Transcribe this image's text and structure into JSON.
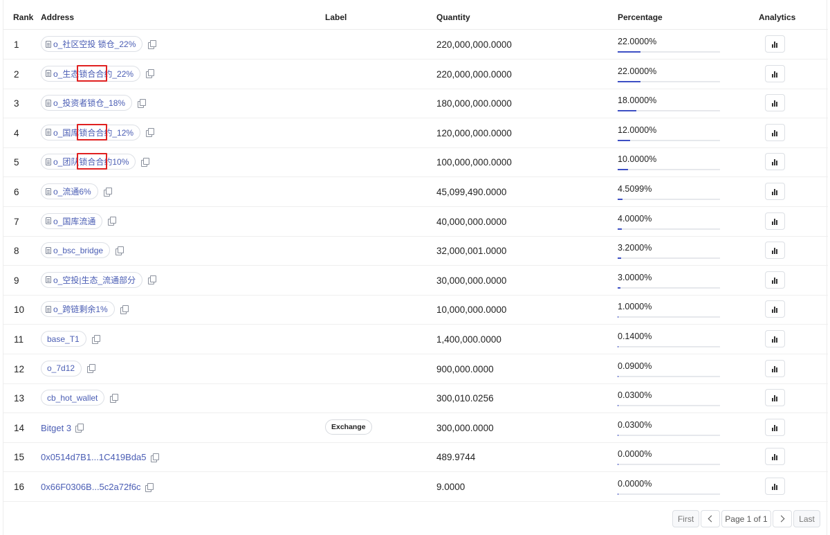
{
  "table": {
    "columns": {
      "rank": "Rank",
      "address": "Address",
      "label": "Label",
      "quantity": "Quantity",
      "percentage": "Percentage",
      "analytics": "Analytics"
    },
    "rows": [
      {
        "rank": "1",
        "address": "o_社区空投 锁仓_22%",
        "address_style": "pill-doc",
        "label": "",
        "quantity": "220,000,000.0000",
        "percentage": "22.0000%",
        "pct_value": 22.0
      },
      {
        "rank": "2",
        "address": "o_生态锁合合约_22%",
        "address_style": "pill-doc",
        "label": "",
        "quantity": "220,000,000.0000",
        "percentage": "22.0000%",
        "pct_value": 22.0
      },
      {
        "rank": "3",
        "address": "o_投资者锁仓_18%",
        "address_style": "pill-doc",
        "label": "",
        "quantity": "180,000,000.0000",
        "percentage": "18.0000%",
        "pct_value": 18.0
      },
      {
        "rank": "4",
        "address": "o_国库锁合合约_12%",
        "address_style": "pill-doc",
        "label": "",
        "quantity": "120,000,000.0000",
        "percentage": "12.0000%",
        "pct_value": 12.0
      },
      {
        "rank": "5",
        "address": "o_团队锁合合约10%",
        "address_style": "pill-doc",
        "label": "",
        "quantity": "100,000,000.0000",
        "percentage": "10.0000%",
        "pct_value": 10.0
      },
      {
        "rank": "6",
        "address": "o_流通6%",
        "address_style": "pill-doc",
        "label": "",
        "quantity": "45,099,490.0000",
        "percentage": "4.5099%",
        "pct_value": 4.5099
      },
      {
        "rank": "7",
        "address": "o_国库流通",
        "address_style": "pill-doc",
        "label": "",
        "quantity": "40,000,000.0000",
        "percentage": "4.0000%",
        "pct_value": 4.0
      },
      {
        "rank": "8",
        "address": "o_bsc_bridge",
        "address_style": "pill-doc",
        "label": "",
        "quantity": "32,000,001.0000",
        "percentage": "3.2000%",
        "pct_value": 3.2
      },
      {
        "rank": "9",
        "address": "o_空投|生态_流通部分",
        "address_style": "pill-doc",
        "label": "",
        "quantity": "30,000,000.0000",
        "percentage": "3.0000%",
        "pct_value": 3.0
      },
      {
        "rank": "10",
        "address": "o_跨链剩余1%",
        "address_style": "pill-doc",
        "label": "",
        "quantity": "10,000,000.0000",
        "percentage": "1.0000%",
        "pct_value": 1.0
      },
      {
        "rank": "11",
        "address": "base_T1",
        "address_style": "pill",
        "label": "",
        "quantity": "1,400,000.0000",
        "percentage": "0.1400%",
        "pct_value": 0.14
      },
      {
        "rank": "12",
        "address": "o_7d12",
        "address_style": "pill",
        "label": "",
        "quantity": "900,000.0000",
        "percentage": "0.0900%",
        "pct_value": 0.09
      },
      {
        "rank": "13",
        "address": "cb_hot_wallet",
        "address_style": "pill",
        "label": "",
        "quantity": "300,010.0256",
        "percentage": "0.0300%",
        "pct_value": 0.03
      },
      {
        "rank": "14",
        "address": "Bitget 3",
        "address_style": "link",
        "label": "Exchange",
        "quantity": "300,000.0000",
        "percentage": "0.0300%",
        "pct_value": 0.03
      },
      {
        "rank": "15",
        "address": "0x0514d7B1...1C419Bda5",
        "address_style": "link",
        "label": "",
        "quantity": "489.9744",
        "percentage": "0.0000%",
        "pct_value": 0.0
      },
      {
        "rank": "16",
        "address": "0x66F0306B...5c2a72f6c",
        "address_style": "link",
        "label": "",
        "quantity": "9.0000",
        "percentage": "0.0000%",
        "pct_value": 0.0
      }
    ]
  },
  "highlights": [
    {
      "row": 2,
      "covers": "锁合合约"
    },
    {
      "row": 4,
      "covers": "锁合合约"
    },
    {
      "row": 5,
      "covers": "锁合合约"
    }
  ],
  "pagination": {
    "first": "First",
    "page_info": "Page 1 of 1",
    "last": "Last"
  },
  "icons": {
    "address_type": "document-icon",
    "copy": "copy-icon",
    "analytics": "bar-chart-icon",
    "prev": "chevron-left-icon",
    "next": "chevron-right-icon"
  },
  "colors": {
    "link": "#4a5db4",
    "bar_fill": "#3d4fc4",
    "highlight": "#e02020"
  }
}
